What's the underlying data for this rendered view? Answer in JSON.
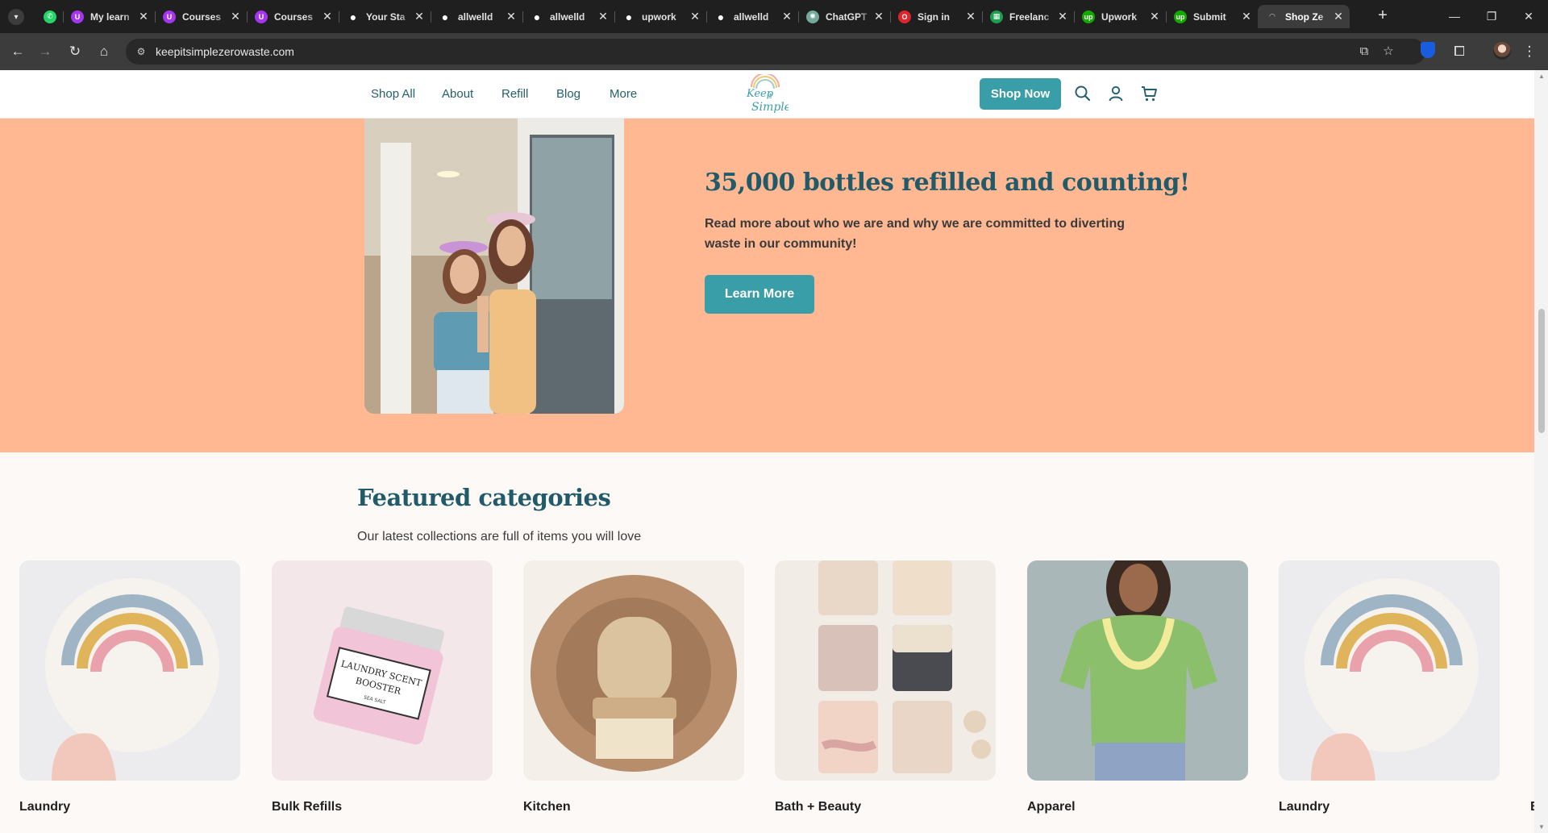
{
  "browser": {
    "tabs": [
      {
        "title": "My learn",
        "icon": "udemy-icon",
        "color": "#a435f0"
      },
      {
        "title": "Courses",
        "icon": "udemy-icon",
        "color": "#a435f0"
      },
      {
        "title": "Courses",
        "icon": "udemy-icon",
        "color": "#a435f0"
      },
      {
        "title": "Your Sta",
        "icon": "github-icon",
        "color": "#ffffff"
      },
      {
        "title": "allwelld",
        "icon": "github-icon",
        "color": "#ffffff"
      },
      {
        "title": "allwelld",
        "icon": "github-icon",
        "color": "#ffffff"
      },
      {
        "title": "upwork",
        "icon": "github-icon",
        "color": "#ffffff"
      },
      {
        "title": "allwelld",
        "icon": "github-icon",
        "color": "#ffffff"
      },
      {
        "title": "ChatGPT",
        "icon": "chatgpt-icon",
        "color": "#74aa9c"
      },
      {
        "title": "Sign in",
        "icon": "opera-icon",
        "color": "#e0242b"
      },
      {
        "title": "Freelanc",
        "icon": "sheets-icon",
        "color": "#1e9e4f"
      },
      {
        "title": "Upwork",
        "icon": "upwork-icon",
        "color": "#14a800"
      },
      {
        "title": "Submit",
        "icon": "upwork-icon",
        "color": "#14a800"
      },
      {
        "title": "Shop Ze",
        "icon": "loading-icon",
        "color": "#cccccc",
        "active": true
      }
    ],
    "url": "keepitsimplezerowaste.com"
  },
  "header": {
    "nav": [
      "Shop All",
      "About",
      "Refill",
      "Blog",
      "More"
    ],
    "logo_text": [
      "Keep",
      "it",
      "Simple"
    ],
    "shop_now": "Shop Now"
  },
  "hero": {
    "title": "35,000 bottles refilled and counting!",
    "text": "Read more about who we are and why we are committed to diverting waste in our community!",
    "cta": "Learn More"
  },
  "featured": {
    "title": "Featured categories",
    "subtitle": "Our latest collections are full of items you will love",
    "categories": [
      {
        "label": "Laundry",
        "image": "wool-dryer-ball"
      },
      {
        "label": "Bulk Refills",
        "image": "laundry-scent-booster-jar",
        "jar_text": [
          "LAUNDRY SCENT",
          "BOOSTER",
          "SEA SALT"
        ]
      },
      {
        "label": "Kitchen",
        "image": "bamboo-dish-brush"
      },
      {
        "label": "Bath + Beauty",
        "image": "handmade-soap-bars"
      },
      {
        "label": "Apparel",
        "image": "green-lei-t-shirt"
      },
      {
        "label": "Laundry",
        "image": "wool-dryer-ball"
      },
      {
        "label": "B",
        "image": "partial-card"
      }
    ]
  },
  "colors": {
    "teal": "#3a9ea8",
    "heading": "#215b69",
    "hero_bg": "#ffb892"
  }
}
